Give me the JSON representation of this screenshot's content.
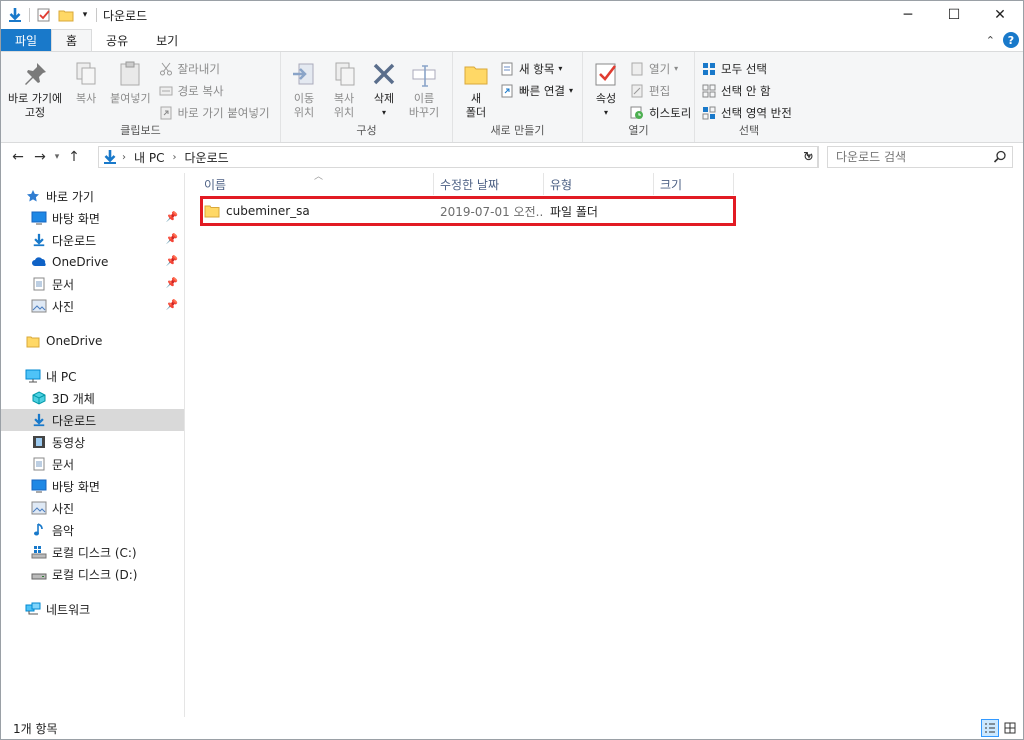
{
  "window": {
    "title": "다운로드",
    "controls": {
      "minimize": "─",
      "maximize": "☐",
      "close": "✕"
    }
  },
  "ribbon_tabs": [
    {
      "label": "파일"
    },
    {
      "label": "홈"
    },
    {
      "label": "공유"
    },
    {
      "label": "보기"
    }
  ],
  "ribbon": {
    "clipboard": {
      "label": "클립보드",
      "pin_line1": "바로 가기에",
      "pin_line2": "고정",
      "copy": "복사",
      "paste": "붙여넣기",
      "cut": "잘라내기",
      "copy_path": "경로 복사",
      "paste_shortcut": "바로 가기 붙여넣기"
    },
    "organize": {
      "label": "구성",
      "move_line1": "이동",
      "move_line2": "위치",
      "copyto_line1": "복사",
      "copyto_line2": "위치",
      "delete": "삭제",
      "rename_line1": "이름",
      "rename_line2": "바꾸기"
    },
    "new": {
      "label": "새로 만들기",
      "folder_line1": "새",
      "folder_line2": "폴더",
      "new_item": "새 항목",
      "easy_access": "빠른 연결"
    },
    "open": {
      "label": "열기",
      "properties": "속성",
      "open": "열기",
      "edit": "편집",
      "history": "히스토리"
    },
    "select": {
      "label": "선택",
      "select_all": "모두 선택",
      "select_none": "선택 안 함",
      "invert": "선택 영역 반전"
    }
  },
  "address": {
    "crumbs": [
      "내 PC",
      "다운로드"
    ],
    "search_placeholder": "다운로드 검색"
  },
  "nav": {
    "quick_access": "바로 가기",
    "quick_items": [
      "바탕 화면",
      "다운로드",
      "OneDrive",
      "문서",
      "사진"
    ],
    "onedrive": "OneDrive",
    "this_pc": "내 PC",
    "pc_items": [
      "3D 개체",
      "다운로드",
      "동영상",
      "문서",
      "바탕 화면",
      "사진",
      "음악",
      "로컬 디스크 (C:)",
      "로컬 디스크 (D:)"
    ],
    "network": "네트워크"
  },
  "columns": {
    "name": "이름",
    "modified": "수정한 날짜",
    "type": "유형",
    "size": "크기"
  },
  "files": [
    {
      "name": "cubeminer_sa",
      "modified": "2019-07-01 오전...",
      "type": "파일 폴더",
      "size": ""
    }
  ],
  "status": {
    "count": "1개 항목"
  },
  "colors": {
    "accent": "#1979ca",
    "highlight": "#e21b23",
    "selected": "#d9d9d9"
  }
}
